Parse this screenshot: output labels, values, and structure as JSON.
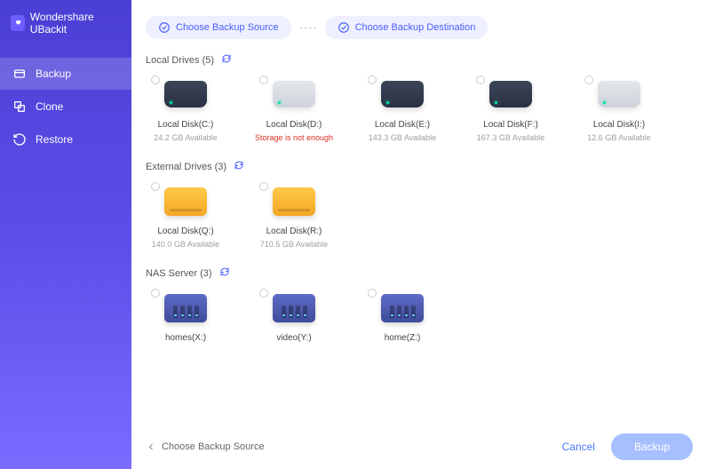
{
  "app": {
    "title": "Wondershare UBackit"
  },
  "sidebar": {
    "items": [
      {
        "label": "Backup"
      },
      {
        "label": "Clone"
      },
      {
        "label": "Restore"
      }
    ]
  },
  "steps": {
    "source": "Choose Backup Source",
    "dest": "Choose Backup Destination"
  },
  "sections": {
    "local": {
      "title": "Local Drives (5)"
    },
    "external": {
      "title": "External Drives (3)"
    },
    "nas": {
      "title": "NAS Server (3)"
    }
  },
  "local_drives": [
    {
      "name": "Local Disk(C:)",
      "sub": "24.2 GB Available",
      "err": false,
      "dark": true
    },
    {
      "name": "Local Disk(D:)",
      "sub": "Storage is not enough",
      "err": true,
      "dark": false
    },
    {
      "name": "Local Disk(E:)",
      "sub": "143.3 GB Available",
      "err": false,
      "dark": true
    },
    {
      "name": "Local Disk(F:)",
      "sub": "167.3 GB Available",
      "err": false,
      "dark": true
    },
    {
      "name": "Local Disk(I:)",
      "sub": "12.6 GB Available",
      "err": false,
      "dark": false
    }
  ],
  "external_drives": [
    {
      "name": "Local Disk(Q:)",
      "sub": "140.0 GB Available"
    },
    {
      "name": "Local Disk(R:)",
      "sub": "710.5 GB Available"
    }
  ],
  "nas_drives": [
    {
      "name": "homes(X:)"
    },
    {
      "name": "video(Y:)"
    },
    {
      "name": "home(Z:)"
    }
  ],
  "footer": {
    "hint": "Choose Backup Source",
    "cancel": "Cancel",
    "action": "Backup"
  }
}
